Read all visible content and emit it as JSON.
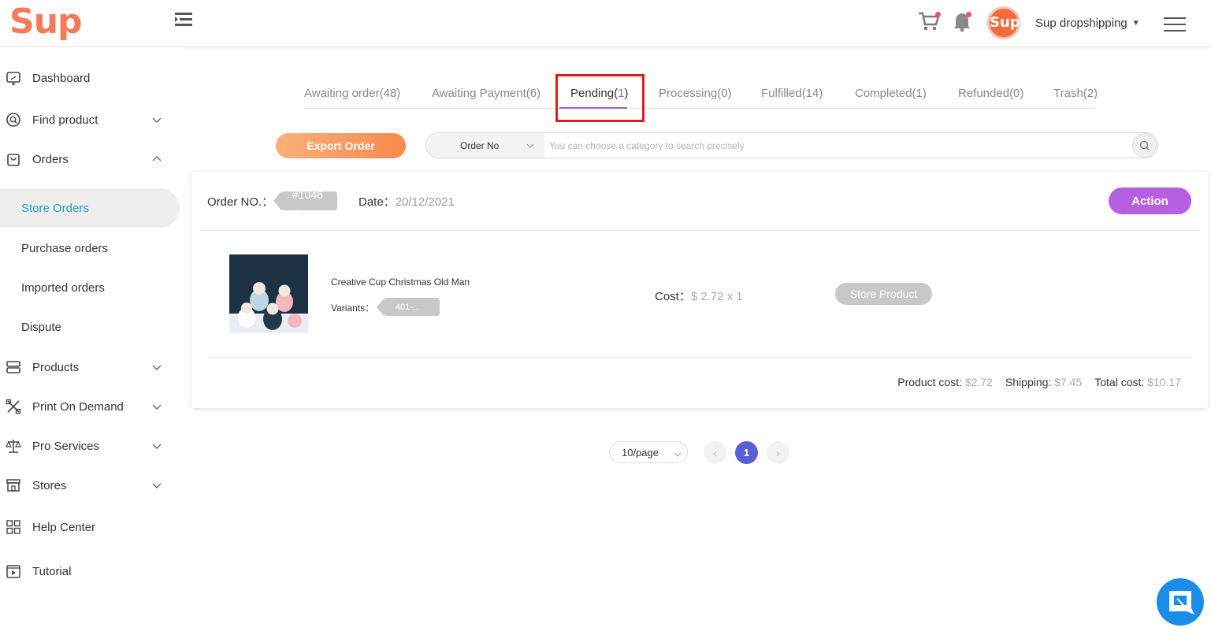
{
  "header": {
    "logo": "Sup",
    "avatar_text": "Sup",
    "account_name": "Sup dropshipping",
    "colors": {
      "brand": "#f47a5a",
      "accent": "#9b5de5",
      "notification": "#f05265"
    }
  },
  "sidebar": {
    "items": [
      {
        "label": "Dashboard",
        "icon": "monitor-icon"
      },
      {
        "label": "Find product",
        "icon": "search-circle-icon"
      },
      {
        "label": "Orders",
        "icon": "bag-icon"
      },
      {
        "label": "Products",
        "icon": "server-icon"
      },
      {
        "label": "Print On Demand",
        "icon": "tools-icon"
      },
      {
        "label": "Pro Services",
        "icon": "scale-icon"
      },
      {
        "label": "Stores",
        "icon": "store-icon"
      },
      {
        "label": "Help Center",
        "icon": "grid-icon"
      },
      {
        "label": "Tutorial",
        "icon": "video-icon"
      }
    ],
    "orders_sub": [
      {
        "label": "Store Orders",
        "active": true
      },
      {
        "label": "Purchase orders"
      },
      {
        "label": "Imported orders"
      },
      {
        "label": "Dispute"
      }
    ]
  },
  "tabs": [
    {
      "name": "Awaiting order",
      "count": "(48)"
    },
    {
      "name": "Awaiting Payment",
      "count": "(6)"
    },
    {
      "name": "Pending",
      "count_open": "(",
      "count_num": "1",
      "count_close": ")",
      "active": true
    },
    {
      "name": "Processing",
      "count": "(0)"
    },
    {
      "name": "Fulfilled",
      "count": "(14)"
    },
    {
      "name": "Completed",
      "count": "(1)"
    },
    {
      "name": "Refunded",
      "count": "(0)"
    },
    {
      "name": "Trash",
      "count": "(2)"
    }
  ],
  "toolbar": {
    "export_label": "Export Order",
    "search_category": "Order No",
    "search_placeholder": "You can choose a category to search precisely"
  },
  "order": {
    "order_no_label": "Order NO.：",
    "order_no": "#1046 ...",
    "date_label": "Date：",
    "date": "20/12/2021",
    "action_label": "Action",
    "product_title": "Creative Cup Christmas Old Man",
    "variants_label": "Variants：",
    "variant_value": "401-...",
    "cost_label": "Cost：",
    "cost_value": "$ 2.72 x 1",
    "store_product_label": "Store Product",
    "product_cost_label": "Product cost:",
    "product_cost": "$2.72",
    "shipping_label": "Shipping:",
    "shipping": "$7.45",
    "total_cost_label": "Total cost:",
    "total_cost": "$10.17"
  },
  "pagination": {
    "page_size": "10/page",
    "prev": "‹",
    "current_page": "1",
    "next": "›"
  }
}
